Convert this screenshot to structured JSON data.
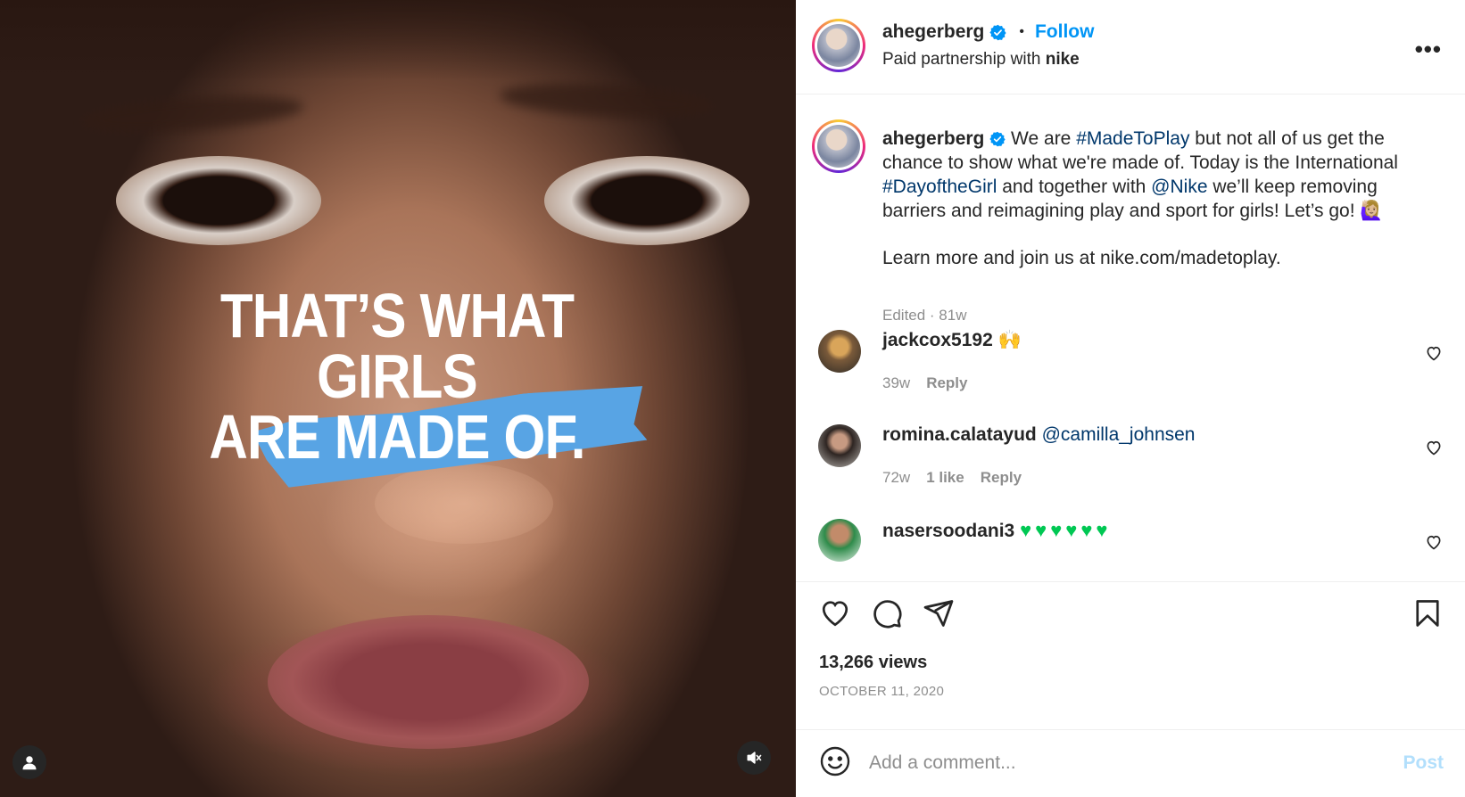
{
  "media": {
    "headline_lines": [
      "THAT’S WHAT",
      "GIRLS",
      "ARE MADE OF."
    ],
    "user_icon": "user-icon",
    "mute_icon": "muted-speaker-icon",
    "brush_color": "#58a4e4"
  },
  "header": {
    "username": "ahegerberg",
    "separator": "•",
    "follow_label": "Follow",
    "subtitle_prefix": "Paid partnership with",
    "partner": "nike",
    "more_icon": "more-options-icon",
    "more_label": "•••"
  },
  "caption": {
    "username": "ahegerberg",
    "text_1": " We are ",
    "tag_1": "#MadeToPlay",
    "text_2": " but not all of us get the chance to show what we're made of. Today is the International ",
    "tag_2": "#DayoftheGirl",
    "text_3": " and together with ",
    "tag_3": "@Nike",
    "text_4": " we’ll keep removing barriers and reimagining play and sport for girls! Let’s go! 🙋🏼‍♀️",
    "text_5": "Learn more and join us at nike.com/madetoplay.",
    "meta": "Edited · 81w"
  },
  "comments": [
    {
      "username": "jackcox5192",
      "text": "🙌",
      "time": "39w",
      "likes": "",
      "reply": "Reply"
    },
    {
      "username": "romina.calatayud",
      "text": "@camilla_johnsen",
      "time": "72w",
      "likes": "1 like",
      "reply": "Reply"
    },
    {
      "username": "nasersoodani3",
      "text": "♥♥♥♥♥♥",
      "time": "",
      "likes": "",
      "reply": ""
    }
  ],
  "actions": {
    "like_icon": "heart-icon",
    "comment_icon": "comment-icon",
    "share_icon": "share-icon",
    "save_icon": "bookmark-icon",
    "views": "13,266 views",
    "date": "OCTOBER 11, 2020"
  },
  "composer": {
    "placeholder": "Add a comment...",
    "post_label": "Post",
    "emoji_icon": "emoji-icon"
  },
  "colors": {
    "accent": "#0095f6",
    "link": "#00376b",
    "muted": "#8e8e8e",
    "post_disabled": "#b2dffc"
  }
}
